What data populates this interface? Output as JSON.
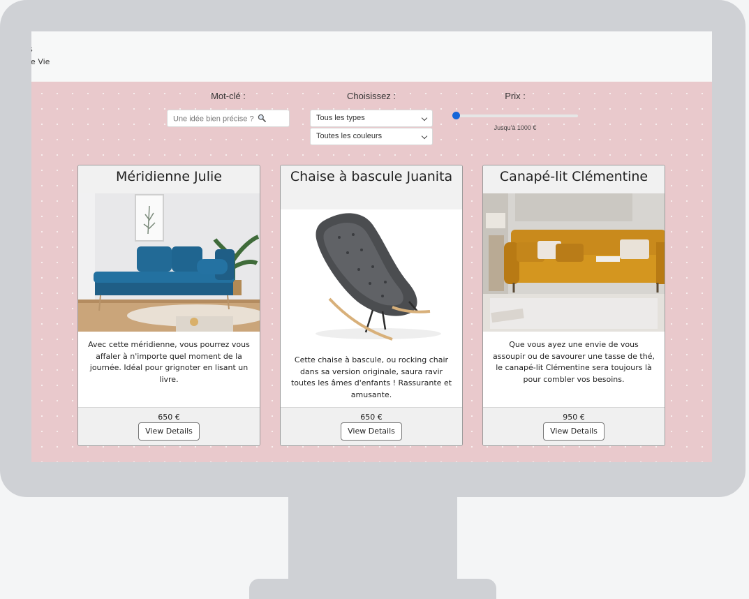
{
  "topbar": {
    "line1": "s",
    "line2": "le Vie"
  },
  "filters": {
    "keyword_label": "Mot-clé :",
    "search_placeholder": "Une idée bien précise ?",
    "choose_label": "Choisissez :",
    "type_select": "Tous les types",
    "color_select": "Toutes les couleurs",
    "price_label": "Prix :",
    "price_value": "Jusqu'à 1000 €",
    "price_slider_fraction": 0.0
  },
  "cards": [
    {
      "title": "Méridienne Julie",
      "image": "blue-velvet-daybed",
      "description": "Avec cette méridienne, vous pourrez vous affaler à n'importe quel moment de la journée. Idéal pour grignoter en lisant un livre.",
      "price": "650 €",
      "button": "View Details"
    },
    {
      "title": "Chaise à bascule Juanita",
      "image": "grey-rocking-chair",
      "description": "Cette chaise à bascule, ou rocking chair dans sa version originale, saura ravir toutes les âmes d'enfants ! Rassurante et amusante.",
      "price": "650 €",
      "button": "View Details"
    },
    {
      "title": "Canapé-lit Clémentine",
      "image": "mustard-sofa-bed",
      "description": "Que vous ayez une envie de vous assoupir ou de savourer une tasse de thé, le canapé-lit Clémentine sera toujours là pour combler vos besoins.",
      "price": "950 €",
      "button": "View Details"
    }
  ],
  "colors": {
    "accent": "#1565d8",
    "background": "#e9c9cc",
    "monitor": "#cfd1d5"
  }
}
